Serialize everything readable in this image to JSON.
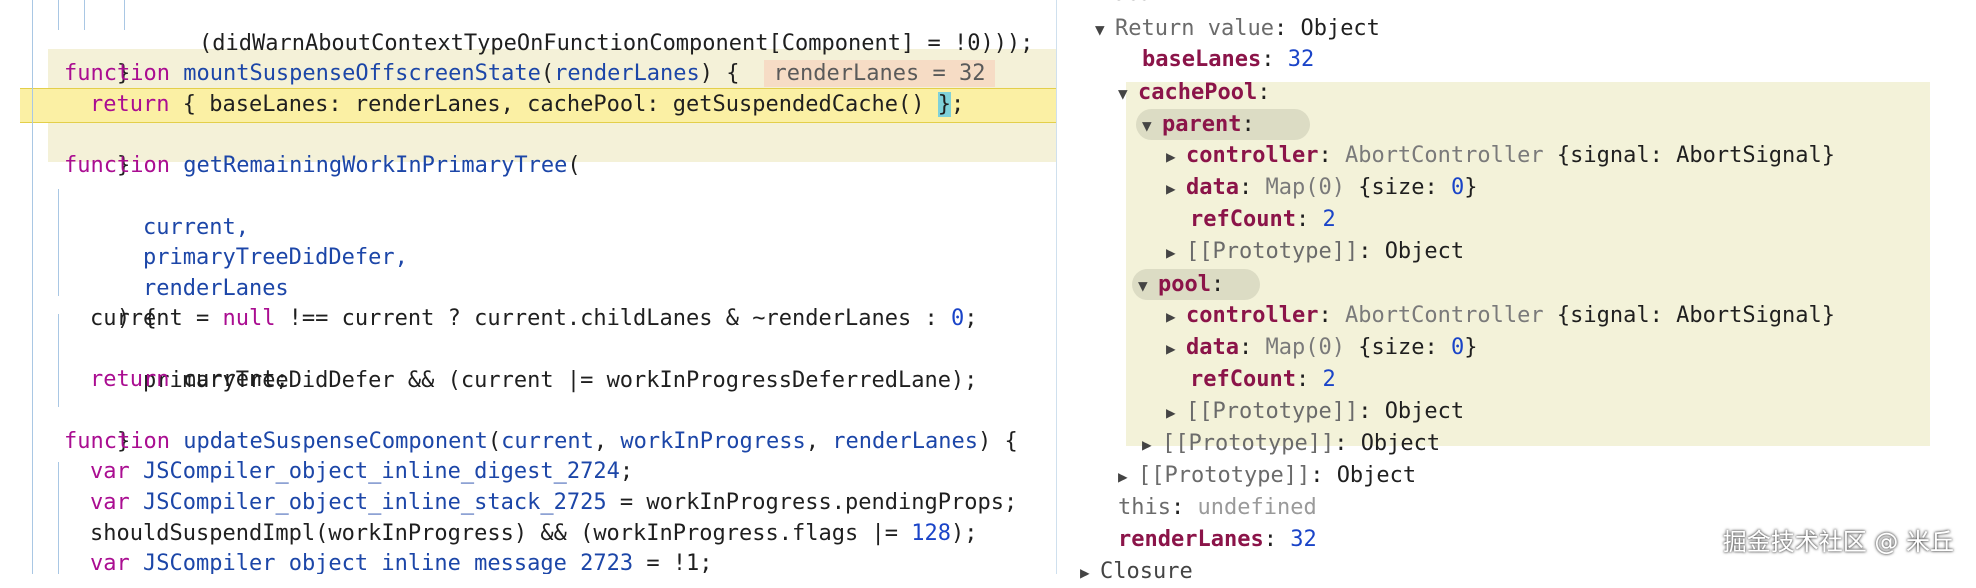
{
  "code": {
    "line1_text": "(didWarnAboutContextTypeOnFunctionComponent[Component] = !0)));",
    "line2_text": "}",
    "line3": {
      "kw": "function",
      "name": "mountSuspenseOffscreenState",
      "open": "(",
      "param": "renderLanes",
      "close": ") {",
      "inline_value": "renderLanes = 32"
    },
    "line4": {
      "kw": "return",
      "text_a": " { baseLanes: renderLanes, cachePool: getSuspendedCache() ",
      "cursor": "}",
      "text_b": ";"
    },
    "line5_text": "}",
    "line6": {
      "kw": "function",
      "name": "getRemainingWorkInPrimaryTree",
      "open": "("
    },
    "line7_text": "current,",
    "line8_text": "primaryTreeDidDefer,",
    "line9_text": "renderLanes",
    "line10_text": ") {",
    "line11": {
      "a": "current = ",
      "kw": "null",
      "b": " !== current ? current.childLanes & ~renderLanes : ",
      "num": "0",
      "c": ";"
    },
    "line12_text": "primaryTreeDidDefer && (current |= workInProgressDeferredLane);",
    "line13": {
      "kw": "return",
      "text": " current;"
    },
    "line14_text": "}",
    "line15": {
      "kw": "function",
      "name": "updateSuspenseComponent",
      "a": "(",
      "p1": "current",
      "b": ", ",
      "p2": "workInProgress",
      "c": ", ",
      "p3": "renderLanes",
      "d": ") {"
    },
    "line16": {
      "kw": "var",
      "name": "JSCompiler_object_inline_digest_2724",
      "rest": ";"
    },
    "line17": {
      "kw": "var",
      "name": "JSCompiler_object_inline_stack_2725",
      "rest": " = workInProgress.pendingProps;"
    },
    "line18": {
      "a": "shouldSuspendImpl(workInProgress) && (workInProgress.flags |= ",
      "num": "128",
      "b": ");"
    },
    "line19": {
      "kw": "var",
      "name": "JSCompiler_object_inline_message_2723",
      "rest": " = !1;"
    }
  },
  "scope": {
    "header_partial": "Local",
    "return_value": {
      "key": "Return value",
      "colon": ": ",
      "value": "Object"
    },
    "base_lanes": {
      "key": "baseLanes",
      "colon": ": ",
      "value": "32"
    },
    "cache_pool": {
      "key": "cachePool",
      "colon": ":"
    },
    "parent": {
      "key": "parent",
      "colon": ":"
    },
    "parent_controller": {
      "key": "controller",
      "colon": ": ",
      "type": "AbortController",
      "value": " {signal: AbortSignal}"
    },
    "parent_data": {
      "key": "data",
      "colon": ": ",
      "type": "Map(0)",
      "value_a": " {size: ",
      "num": "0",
      "value_b": "}"
    },
    "parent_refcount": {
      "key": "refCount",
      "colon": ": ",
      "value": "2"
    },
    "parent_proto": {
      "key": "[[Prototype]]",
      "colon": ": ",
      "value": "Object"
    },
    "pool": {
      "key": "pool",
      "colon": ":"
    },
    "pool_controller": {
      "key": "controller",
      "colon": ": ",
      "type": "AbortController",
      "value": " {signal: AbortSignal}"
    },
    "pool_data": {
      "key": "data",
      "colon": ": ",
      "type": "Map(0)",
      "value_a": " {size: ",
      "num": "0",
      "value_b": "}"
    },
    "pool_refcount": {
      "key": "refCount",
      "colon": ": ",
      "value": "2"
    },
    "pool_proto": {
      "key": "[[Prototype]]",
      "colon": ": ",
      "value": "Object"
    },
    "cachepool_proto": {
      "key": "[[Prototype]]",
      "colon": ": ",
      "value": "Object"
    },
    "return_proto": {
      "key": "[[Prototype]]",
      "colon": ": ",
      "value": "Object"
    },
    "this_row": {
      "key": "this",
      "colon": ": ",
      "value": "undefined"
    },
    "render_lanes": {
      "key": "renderLanes",
      "colon": ": ",
      "value": "32"
    },
    "closure_partial": "Closure"
  },
  "watermark": "掘金技术社区 @ 米丘",
  "icons": {
    "expanded": "triangle-down",
    "collapsed": "triangle-right"
  },
  "colors": {
    "keyword": "#aa0d91",
    "function_name": "#1c46a8",
    "number": "#1a44c8",
    "scope_key": "#8b1449",
    "execution_line": "#fbf0a4",
    "function_band": "#f4f1d8",
    "inline_value_bg": "#f6dcc5"
  }
}
